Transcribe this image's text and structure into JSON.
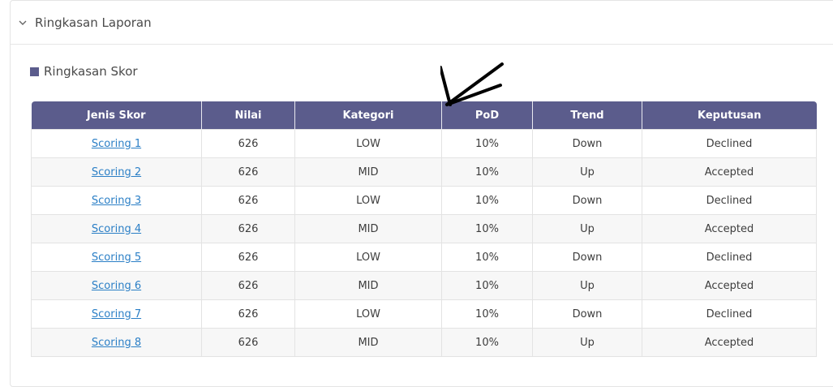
{
  "panel": {
    "title": "Ringkasan Laporan",
    "chevron_icon": "chevron-down-icon"
  },
  "section": {
    "title": "Ringkasan Skor",
    "marker_color": "#5b5c8c"
  },
  "table": {
    "headers": [
      "Jenis Skor",
      "Nilai",
      "Kategori",
      "PoD",
      "Trend",
      "Keputusan"
    ],
    "rows": [
      {
        "jenis": "Scoring 1",
        "nilai": "626",
        "kategori": "LOW",
        "pod": "10%",
        "trend": "Down",
        "keputusan": "Declined"
      },
      {
        "jenis": "Scoring 2",
        "nilai": "626",
        "kategori": "MID",
        "pod": "10%",
        "trend": "Up",
        "keputusan": "Accepted"
      },
      {
        "jenis": "Scoring 3",
        "nilai": "626",
        "kategori": "LOW",
        "pod": "10%",
        "trend": "Down",
        "keputusan": "Declined"
      },
      {
        "jenis": "Scoring 4",
        "nilai": "626",
        "kategori": "MID",
        "pod": "10%",
        "trend": "Up",
        "keputusan": "Accepted"
      },
      {
        "jenis": "Scoring 5",
        "nilai": "626",
        "kategori": "LOW",
        "pod": "10%",
        "trend": "Down",
        "keputusan": "Declined"
      },
      {
        "jenis": "Scoring 6",
        "nilai": "626",
        "kategori": "MID",
        "pod": "10%",
        "trend": "Up",
        "keputusan": "Accepted"
      },
      {
        "jenis": "Scoring 7",
        "nilai": "626",
        "kategori": "LOW",
        "pod": "10%",
        "trend": "Down",
        "keputusan": "Declined"
      },
      {
        "jenis": "Scoring 8",
        "nilai": "626",
        "kategori": "MID",
        "pod": "10%",
        "trend": "Up",
        "keputusan": "Accepted"
      }
    ]
  },
  "colors": {
    "header_bg": "#5b5c8c",
    "link": "#2b7fc6",
    "annotation": "#000000"
  }
}
